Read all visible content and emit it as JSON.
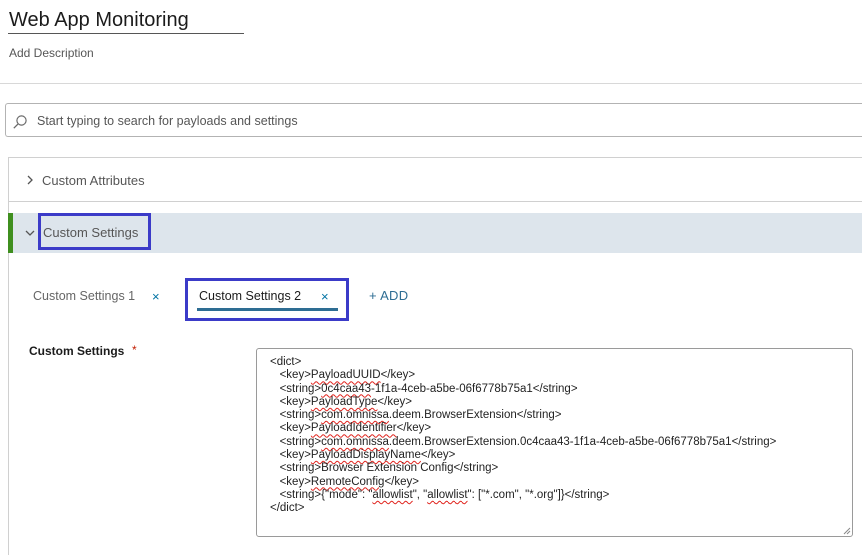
{
  "profile": {
    "title": "Web App Monitoring",
    "add_description": "Add Description"
  },
  "search": {
    "placeholder": "Start typing to search for payloads and settings"
  },
  "accordion": {
    "custom_attributes": "Custom Attributes",
    "custom_settings": "Custom Settings"
  },
  "tabs": [
    {
      "label": "Custom Settings 1",
      "close": "×"
    },
    {
      "label": "Custom Settings 2",
      "close": "×"
    }
  ],
  "add_label": "+ ADD",
  "field": {
    "label": "Custom Settings",
    "required_marker": "*"
  },
  "code": {
    "l1": "<dict>",
    "l2a": "<key>",
    "l2b": "PayloadUUID",
    "l2c": "</key>",
    "l3a": "<string>",
    "l3b": "0c4caa43",
    "l3c": "-1f1a-4ceb-a5be-06f6778b75a1</string>",
    "l4a": "<key>",
    "l4b": "PayloadType",
    "l4c": "</key>",
    "l5a": "<string>",
    "l5b": "com.omnissa",
    "l5c": ".deem.BrowserExtension</string>",
    "l6a": "<key>",
    "l6b": "PayloadIdentifier",
    "l6c": "</key>",
    "l7a": "<string>",
    "l7b": "com.omnissa",
    "l7c": ".deem.BrowserExtension.0c4caa43-1f1a-4ceb-a5be-06f6778b75a1</string>",
    "l8a": "<key>",
    "l8b": "PayloadDisplayName",
    "l8c": "</key>",
    "l9": "<string>Browser Extension Config</string>",
    "l10a": "<key>",
    "l10b": "RemoteConfig",
    "l10c": "</key>",
    "l11a": "<string>{\"",
    "l11b": "mode\"",
    "l11c": ": \"",
    "l11d": "allowlist",
    "l11e": "\", \"",
    "l11f": "allowlist",
    "l11g": "\": [\"*.com\", \"*.org\"]}</string>",
    "l12": "</dict>"
  },
  "colors": {
    "accent": "#2e6d93",
    "active_row_bg": "#dde5ec",
    "green_indicator": "#3f8f1f",
    "highlight_box": "#3b3bc8",
    "required": "#c21d00"
  }
}
